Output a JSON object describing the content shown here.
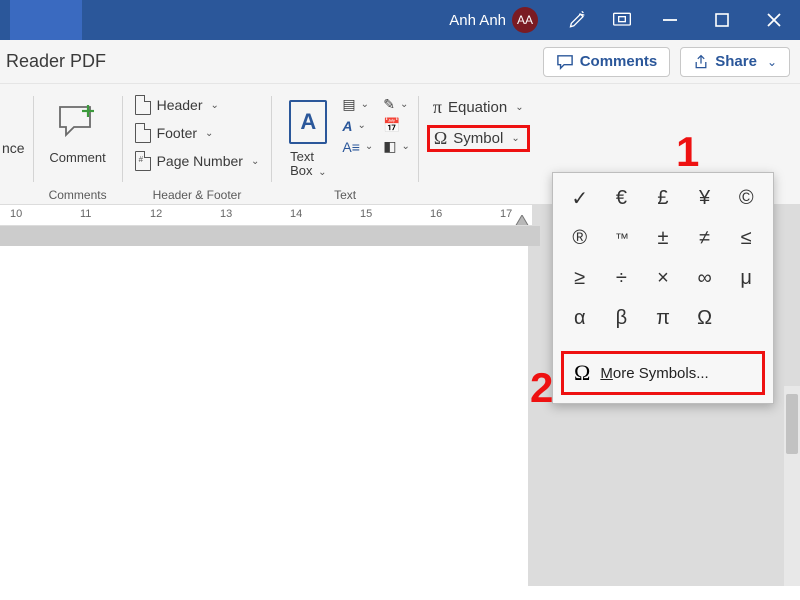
{
  "titlebar": {
    "user_name": "Anh Anh",
    "avatar_initials": "AA"
  },
  "actions": {
    "left_label": "Reader PDF",
    "comments": "Comments",
    "share": "Share"
  },
  "ribbon": {
    "left_cut_label": "nce",
    "comments_group": {
      "label": "Comments",
      "comment": "Comment"
    },
    "header_footer_group": {
      "label": "Header & Footer",
      "header": "Header",
      "footer": "Footer",
      "page_number": "Page Number"
    },
    "text_group": {
      "label": "Text",
      "text_box_top": "Text",
      "text_box_bottom": "Box"
    },
    "symbols_group": {
      "equation": "Equation",
      "symbol": "Symbol"
    }
  },
  "ruler": {
    "numbers": [
      "10",
      "11",
      "12",
      "13",
      "14",
      "15",
      "16",
      "17"
    ]
  },
  "symbol_panel": {
    "grid": [
      "check",
      "€",
      "£",
      "¥",
      "©",
      "®",
      "™",
      "±",
      "≠",
      "≤",
      "≥",
      "÷",
      "×",
      "∞",
      "μ",
      "α",
      "β",
      "π",
      "Ω"
    ],
    "more_symbols_prefix": "M",
    "more_symbols_rest": "ore Symbols..."
  },
  "callouts": {
    "one": "1",
    "two": "2"
  }
}
